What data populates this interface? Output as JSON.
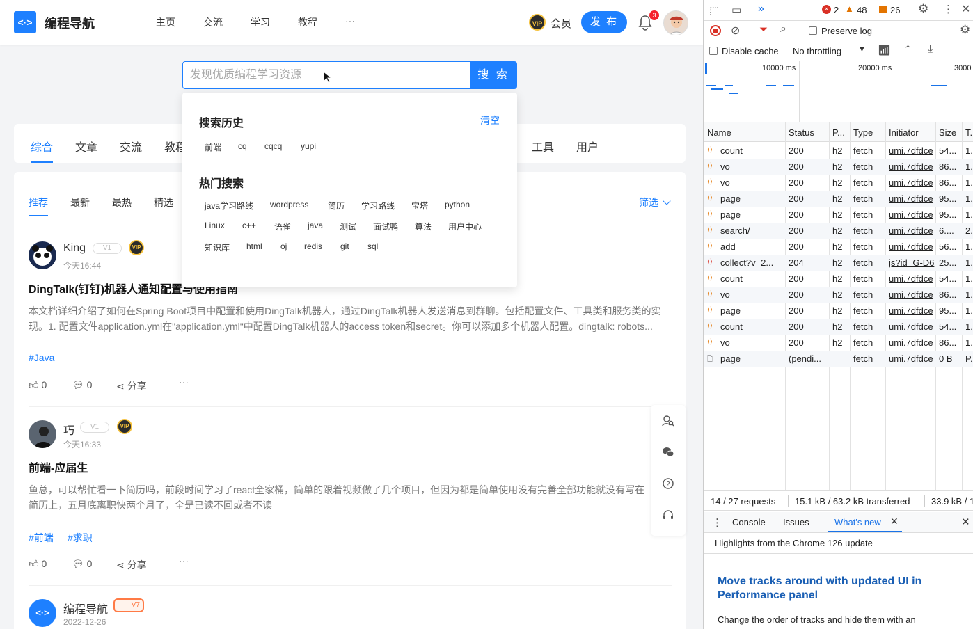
{
  "site": {
    "name": "编程导航",
    "logo_text": "<·>"
  },
  "nav": {
    "items": [
      "主页",
      "交流",
      "学习",
      "教程",
      "···"
    ]
  },
  "header": {
    "vip_label": "会员",
    "vip_badge": "VIP",
    "publish": "发 布",
    "notif_count": "3"
  },
  "search": {
    "placeholder": "发现优质编程学习资源",
    "button": "搜 索"
  },
  "dropdown": {
    "history_title": "搜索历史",
    "clear": "清空",
    "history": [
      "前端",
      "cq",
      "cqcq",
      "yupi"
    ],
    "hot_title": "热门搜索",
    "hot_row1": [
      "java学习路线",
      "wordpress",
      "简历",
      "学习路线",
      "宝塔",
      "python"
    ],
    "hot_row2": [
      "Linux",
      "c++",
      "语雀",
      "java",
      "测试",
      "面试鸭",
      "算法",
      "用户中心"
    ],
    "hot_row3": [
      "知识库",
      "html",
      "oj",
      "redis",
      "git",
      "sql"
    ]
  },
  "tabs": [
    "综合",
    "文章",
    "交流",
    "教程",
    "工具",
    "用户"
  ],
  "subtabs": [
    "推荐",
    "最新",
    "最热",
    "精选"
  ],
  "filter": "筛选",
  "posts": [
    {
      "author": "King",
      "level": "V1",
      "time": "今天16:44",
      "title": "DingTalk(钉钉)机器人通知配置与使用指南",
      "summary": "本文档详细介绍了如何在Spring Boot项目中配置和使用DingTalk机器人，通过DingTalk机器人发送消息到群聊。包括配置文件、工具类和服务类的实现。1. 配置文件application.yml在\"application.yml\"中配置DingTalk机器人的access token和secret。你可以添加多个机器人配置。dingtalk: robots...",
      "tags": [
        "#Java"
      ],
      "likes": "0",
      "comments": "0",
      "share": "分享",
      "more": "···"
    },
    {
      "author": "巧",
      "level": "V1",
      "time": "今天16:33",
      "title": "前端-应届生",
      "summary": "鱼总，可以帮忙看一下简历吗，前段时间学习了react全家桶，简单的跟着视频做了几个项目，但因为都是简单使用没有完善全部功能就没有写在简历上，五月底离职快两个月了，全是已读不回或者不读",
      "tags": [
        "#前端",
        "#求职"
      ],
      "likes": "0",
      "comments": "0",
      "share": "分享",
      "more": "···"
    },
    {
      "author": "编程导航",
      "level": "V7",
      "time": "2022-12-26"
    }
  ],
  "devtools": {
    "errors": "2",
    "warnings": "48",
    "issues": "26",
    "preserve_log": "Preserve log",
    "disable_cache": "Disable cache",
    "throttling": "No throttling",
    "timeline": [
      "10000 ms",
      "20000 ms",
      "3000"
    ],
    "columns": [
      "Name",
      "Status",
      "P...",
      "Type",
      "Initiator",
      "Size",
      "T."
    ],
    "requests": [
      {
        "name": "count",
        "status": "200",
        "proto": "h2",
        "type": "fetch",
        "initiator": "umi.7dfdce",
        "size": "54...",
        "time": "1."
      },
      {
        "name": "vo",
        "status": "200",
        "proto": "h2",
        "type": "fetch",
        "initiator": "umi.7dfdce",
        "size": "86...",
        "time": "1."
      },
      {
        "name": "vo",
        "status": "200",
        "proto": "h2",
        "type": "fetch",
        "initiator": "umi.7dfdce",
        "size": "86...",
        "time": "1."
      },
      {
        "name": "page",
        "status": "200",
        "proto": "h2",
        "type": "fetch",
        "initiator": "umi.7dfdce",
        "size": "95...",
        "time": "1."
      },
      {
        "name": "page",
        "status": "200",
        "proto": "h2",
        "type": "fetch",
        "initiator": "umi.7dfdce",
        "size": "95...",
        "time": "1."
      },
      {
        "name": "search/",
        "status": "200",
        "proto": "h2",
        "type": "fetch",
        "initiator": "umi.7dfdce",
        "size": "6....",
        "time": "2."
      },
      {
        "name": "add",
        "status": "200",
        "proto": "h2",
        "type": "fetch",
        "initiator": "umi.7dfdce",
        "size": "56...",
        "time": "1."
      },
      {
        "name": "collect?v=2...",
        "status": "204",
        "proto": "h2",
        "type": "fetch",
        "initiator": "js?id=G-D6",
        "size": "25...",
        "time": "1."
      },
      {
        "name": "count",
        "status": "200",
        "proto": "h2",
        "type": "fetch",
        "initiator": "umi.7dfdce",
        "size": "54...",
        "time": "1."
      },
      {
        "name": "vo",
        "status": "200",
        "proto": "h2",
        "type": "fetch",
        "initiator": "umi.7dfdce",
        "size": "86...",
        "time": "1."
      },
      {
        "name": "page",
        "status": "200",
        "proto": "h2",
        "type": "fetch",
        "initiator": "umi.7dfdce",
        "size": "95...",
        "time": "1."
      },
      {
        "name": "count",
        "status": "200",
        "proto": "h2",
        "type": "fetch",
        "initiator": "umi.7dfdce",
        "size": "54...",
        "time": "1."
      },
      {
        "name": "vo",
        "status": "200",
        "proto": "h2",
        "type": "fetch",
        "initiator": "umi.7dfdce",
        "size": "86...",
        "time": "1."
      },
      {
        "name": "page",
        "status": "(pendi...",
        "proto": "",
        "type": "fetch",
        "initiator": "umi.7dfdce",
        "size": "0 B",
        "time": "P."
      }
    ],
    "summary_requests": "14 / 27 requests",
    "summary_transferred": "15.1 kB / 63.2 kB transferred",
    "summary_resources": "33.9 kB / 1",
    "drawer_tabs": [
      "Console",
      "Issues",
      "What's new"
    ],
    "whats_new_header": "Highlights from the Chrome 126 update",
    "whats_new_title": "Move tracks around with updated UI in Performance panel",
    "whats_new_desc": "Change the order of tracks and hide them with an"
  },
  "colors": {
    "brand": "#1e80ff",
    "error": "#d93025",
    "warning": "#e37400"
  }
}
